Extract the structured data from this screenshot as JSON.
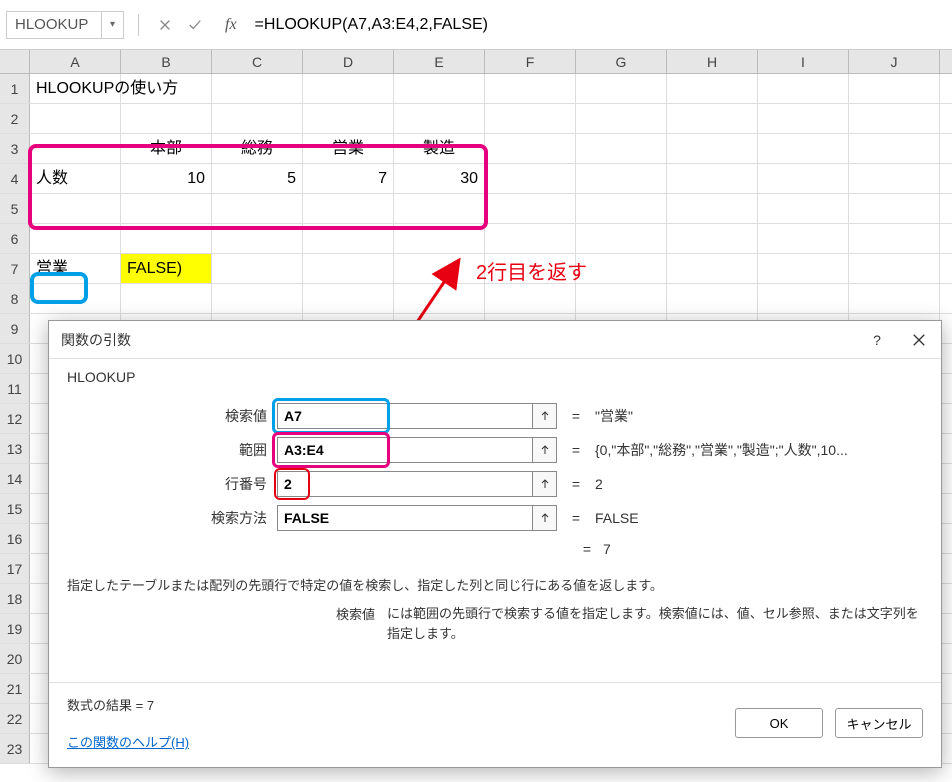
{
  "namebox": {
    "value": "HLOOKUP"
  },
  "formula": "=HLOOKUP(A7,A3:E4,2,FALSE)",
  "columns": [
    "A",
    "B",
    "C",
    "D",
    "E",
    "F",
    "G",
    "H",
    "I",
    "J"
  ],
  "rows": [
    "1",
    "2",
    "3",
    "4",
    "5",
    "6",
    "7",
    "8",
    "9",
    "10",
    "11",
    "12",
    "13",
    "14",
    "15",
    "16",
    "17",
    "18",
    "19",
    "20",
    "21",
    "22",
    "23"
  ],
  "cells": {
    "A1": "HLOOKUPの使い方",
    "B3": "本部",
    "C3": "総務",
    "D3": "営業",
    "E3": "製造",
    "A4": "人数",
    "B4": "10",
    "C4": "5",
    "D4": "7",
    "E4": "30",
    "A7": "営業",
    "B7": "FALSE)"
  },
  "annotation": "2行目を返す",
  "dialog": {
    "title": "関数の引数",
    "function_name": "HLOOKUP",
    "args": [
      {
        "label": "検索値",
        "value": "A7",
        "result": "\"営業\""
      },
      {
        "label": "範囲",
        "value": "A3:E4",
        "result": "{0,\"本部\",\"総務\",\"営業\",\"製造\";\"人数\",10..."
      },
      {
        "label": "行番号",
        "value": "2",
        "result": "2"
      },
      {
        "label": "検索方法",
        "value": "FALSE",
        "result": "FALSE"
      }
    ],
    "final_result_label": "=",
    "final_result": "7",
    "description1": "指定したテーブルまたは配列の先頭行で特定の値を検索し、指定した列と同じ行にある値を返します。",
    "description2_label": "検索値",
    "description2_text": "には範囲の先頭行で検索する値を指定します。検索値には、値、セル参照、または文字列を指定します。",
    "formula_result_label": "数式の結果 = ",
    "formula_result": "7",
    "help_link": "この関数のヘルプ(H)",
    "ok": "OK",
    "cancel": "キャンセル"
  }
}
